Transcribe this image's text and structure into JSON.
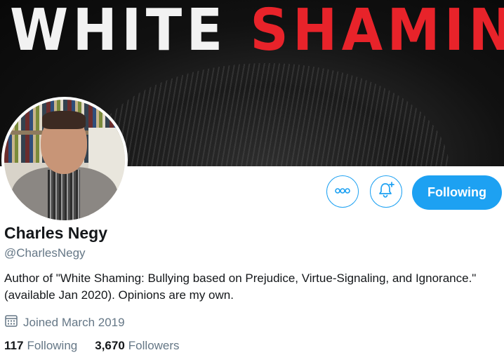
{
  "banner": {
    "title_white": "WHITE",
    "title_red": "SHAMING",
    "colors": {
      "white": "#f2f2f2",
      "red": "#e8232a"
    }
  },
  "profile": {
    "display_name": "Charles Negy",
    "handle": "@CharlesNegy",
    "bio": "Author of \"White Shaming: Bullying based on Prejudice, Virtue-Signaling, and Ignorance.\" (available Jan 2020). Opinions are my own.",
    "joined": "Joined March 2019"
  },
  "actions": {
    "more_icon": "more-horizontal-icon",
    "notify_icon": "bell-plus-icon",
    "follow_label": "Following"
  },
  "stats": {
    "following_count": "117",
    "following_label": "Following",
    "followers_count": "3,670",
    "followers_label": "Followers"
  },
  "colors": {
    "accent": "#1da1f2",
    "secondary_text": "#657786",
    "primary_text": "#14171a"
  }
}
